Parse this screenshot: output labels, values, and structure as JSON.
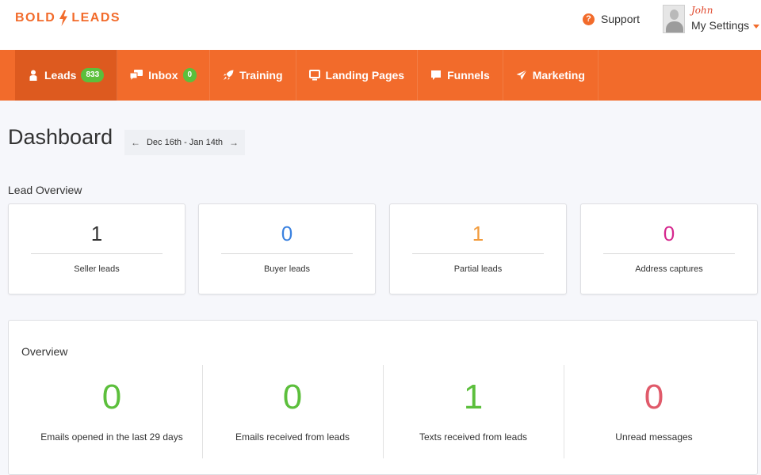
{
  "brand": {
    "part1": "BOLD",
    "part2": "LEADS",
    "color": "#f26b2b"
  },
  "header": {
    "support_label": "Support",
    "user_name": "John",
    "settings_label": "My Settings"
  },
  "nav": {
    "items": [
      {
        "label": "Leads",
        "icon": "person-icon",
        "badge": "833"
      },
      {
        "label": "Inbox",
        "icon": "chat-bubbles-icon",
        "badge": "0"
      },
      {
        "label": "Training",
        "icon": "rocket-icon"
      },
      {
        "label": "Landing Pages",
        "icon": "monitor-icon"
      },
      {
        "label": "Funnels",
        "icon": "speech-bubble-icon"
      },
      {
        "label": "Marketing",
        "icon": "paper-plane-icon"
      }
    ]
  },
  "dashboard": {
    "title": "Dashboard",
    "date_range": "Dec 16th - Jan 14th",
    "prev_arrow": "←",
    "next_arrow": "→"
  },
  "lead_overview": {
    "title": "Lead Overview",
    "cards": [
      {
        "value": "1",
        "label": "Seller leads",
        "color": "#333333"
      },
      {
        "value": "0",
        "label": "Buyer leads",
        "color": "#3b82e0"
      },
      {
        "value": "1",
        "label": "Partial leads",
        "color": "#f29b3c"
      },
      {
        "value": "0",
        "label": "Address captures",
        "color": "#d6288e"
      }
    ]
  },
  "overview": {
    "title": "Overview",
    "stats": [
      {
        "value": "0",
        "label": "Emails opened in the last 29 days",
        "color": "#5cbf3c"
      },
      {
        "value": "0",
        "label": "Emails received from leads",
        "color": "#5cbf3c"
      },
      {
        "value": "1",
        "label": "Texts received from leads",
        "color": "#5cbf3c"
      },
      {
        "value": "0",
        "label": "Unread messages",
        "color": "#e05a6a"
      }
    ]
  }
}
